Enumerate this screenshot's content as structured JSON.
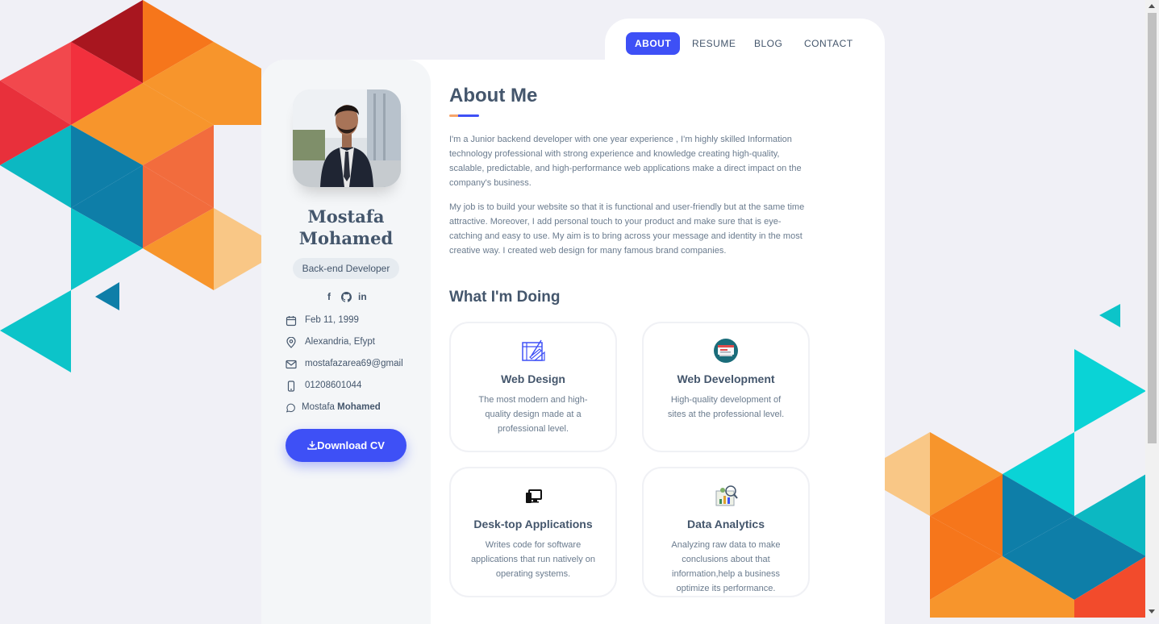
{
  "nav": {
    "items": [
      "ABOUT",
      "RESUME",
      "BLOG",
      "CONTACT"
    ],
    "active": "ABOUT"
  },
  "profile": {
    "name_line1": "Mostafa",
    "name_line2": "Mohamed",
    "role": "Back-end Developer",
    "social": [
      "f",
      "github",
      "in"
    ],
    "birthday": "Feb 11, 1999",
    "location": "Alexandria, Efypt",
    "email": "mostafazarea69@gmail",
    "phone": "01208601044",
    "whatsapp_first": "Mostafa",
    "whatsapp_last": "Mohamed",
    "download_label": "Download CV"
  },
  "about": {
    "title": "About Me",
    "paragraph1": "I'm a Junior backend developer with one year experience , I'm highly skilled Information technology professional with strong experience and knowledge creating high-quality, scalable, predictable, and high-performance web applications make a direct impact on the company's business.",
    "paragraph2": "My job is to build your website so that it is functional and user-friendly but at the same time attractive. Moreover, I add personal touch to your product and make sure that is eye-catching and easy to use. My aim is to bring across your message and identity in the most creative way. I created web design for many famous brand companies."
  },
  "doing": {
    "title": "What I'm Doing",
    "services": [
      {
        "title": "Web Design",
        "desc": "The most modern and high-quality design made at a professional level.",
        "icon": "design-icon"
      },
      {
        "title": "Web Development",
        "desc": "High-quality development of sites at the professional level.",
        "icon": "monitor-code-icon"
      },
      {
        "title": "Desk-top Applications",
        "desc": "Writes code for software applications that run natively on operating systems.",
        "icon": "desktop-icon"
      },
      {
        "title": "Data Analytics",
        "desc": "Analyzing raw data to make conclusions about that information,help a business optimize its performance.",
        "icon": "analytics-icon"
      }
    ]
  },
  "colors": {
    "accent": "#3e50f6",
    "text": "#44566c",
    "muted": "#6a7b8e",
    "page_bg": "#f0f0f6"
  }
}
